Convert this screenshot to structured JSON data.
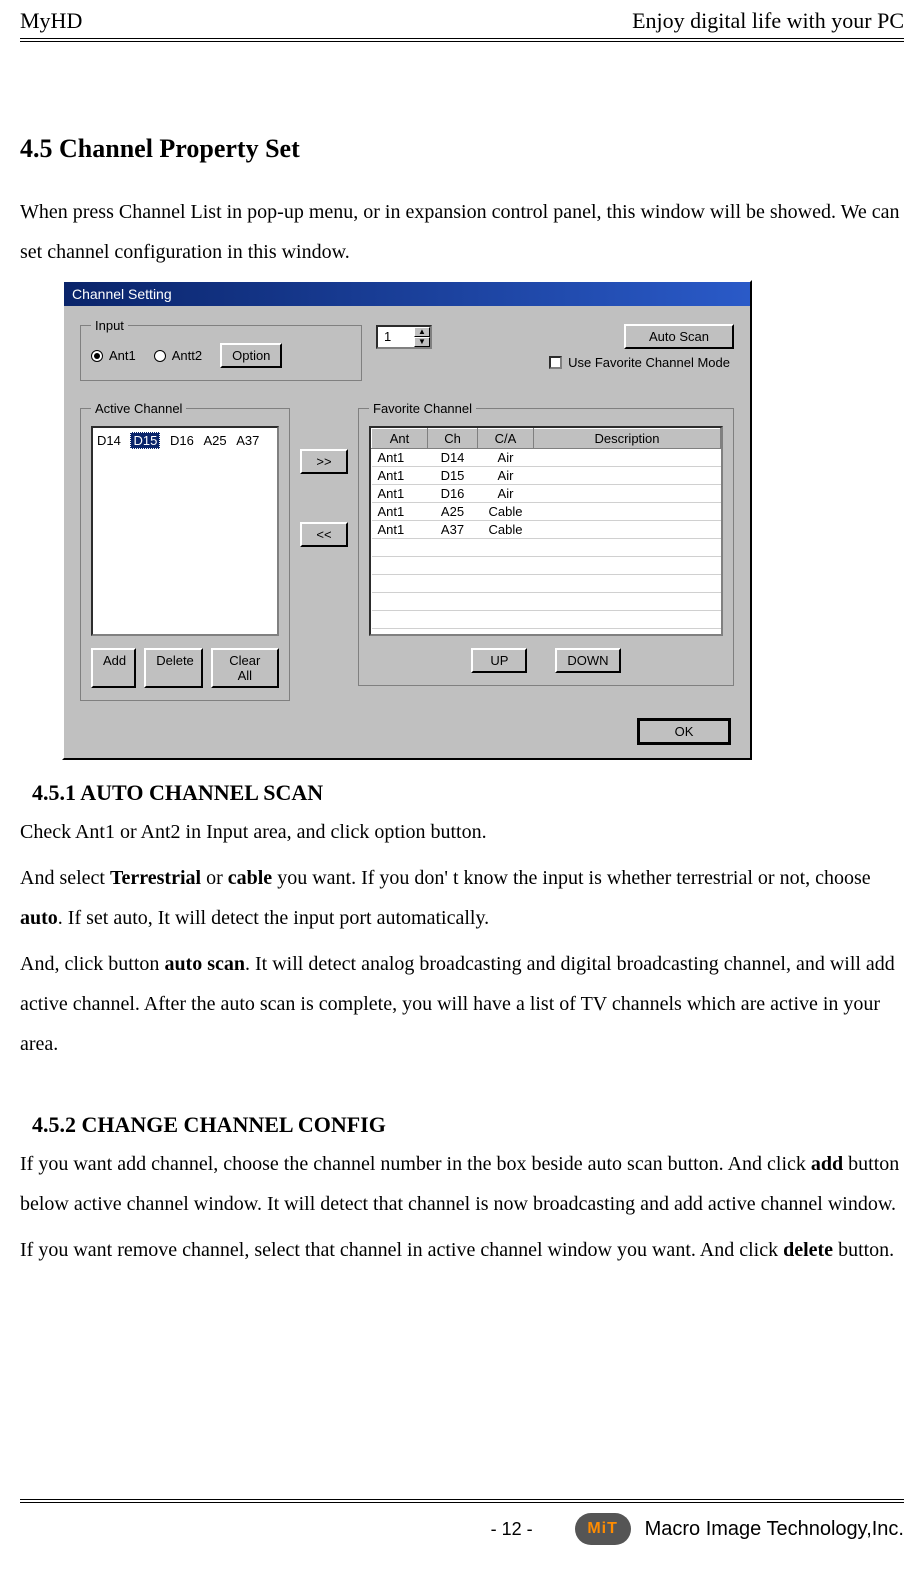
{
  "header": {
    "left": "MyHD",
    "right": "Enjoy digital life with your PC"
  },
  "section": {
    "title": "4.5 Channel Property Set",
    "intro": "When press Channel List in pop-up menu, or in expansion control panel, this window will be showed. We can set channel configuration in this window."
  },
  "dialog": {
    "title": "Channel Setting",
    "input": {
      "legend": "Input",
      "ant1": "Ant1",
      "ant2": "Antt2",
      "option": "Option"
    },
    "spinner_value": "1",
    "auto_scan": "Auto Scan",
    "fav_mode_label": "Use Favorite Channel Mode",
    "active": {
      "legend": "Active Channel",
      "items": [
        "D14",
        "D15",
        "D16",
        "A25",
        "A37"
      ],
      "selected_index": 1,
      "add": "Add",
      "delete": "Delete",
      "clear_all": "Clear All"
    },
    "move_right": ">>",
    "move_left": "<<",
    "favorite": {
      "legend": "Favorite Channel",
      "columns": [
        "Ant",
        "Ch",
        "C/A",
        "Description"
      ],
      "rows": [
        {
          "ant": "Ant1",
          "ch": "D14",
          "ca": "Air",
          "desc": ""
        },
        {
          "ant": "Ant1",
          "ch": "D15",
          "ca": "Air",
          "desc": ""
        },
        {
          "ant": "Ant1",
          "ch": "D16",
          "ca": "Air",
          "desc": ""
        },
        {
          "ant": "Ant1",
          "ch": "A25",
          "ca": "Cable",
          "desc": ""
        },
        {
          "ant": "Ant1",
          "ch": "A37",
          "ca": "Cable",
          "desc": ""
        }
      ],
      "up": "UP",
      "down": "DOWN"
    },
    "ok": "OK"
  },
  "sub1": {
    "title": "4.5.1 AUTO CHANNEL SCAN",
    "p1a": "Check Ant1 or Ant2 in Input area, and click option button.",
    "p2_pre": "And select ",
    "p2_b1": "Terrestrial",
    "p2_mid": " or ",
    "p2_b2": "cable",
    "p2_post": " you want. If you don' t know the input is whether terrestrial or not, choose ",
    "p2_b3": "auto",
    "p2_end": ". If set auto, It will detect the input port automatically.",
    "p3_pre": "And, click button ",
    "p3_b1": "auto scan",
    "p3_post": ". It will detect analog broadcasting and digital broadcasting channel, and will add active channel. After the auto scan is complete, you will have a list of TV channels which are active in your area."
  },
  "sub2": {
    "title": "4.5.2 CHANGE CHANNEL CONFIG",
    "p1_pre": "If you want add channel, choose the channel number in the box beside auto scan button. And click ",
    "p1_b1": "add",
    "p1_post": " button below active channel window. It will detect that channel is now broadcasting and add active channel window.",
    "p2_pre": "If you want remove channel, select that channel in active channel window you want. And click ",
    "p2_b1": "delete",
    "p2_post": " button."
  },
  "footer": {
    "page": "- 12 -",
    "logo_text": "MiT",
    "company": "Macro Image Technology,Inc."
  }
}
